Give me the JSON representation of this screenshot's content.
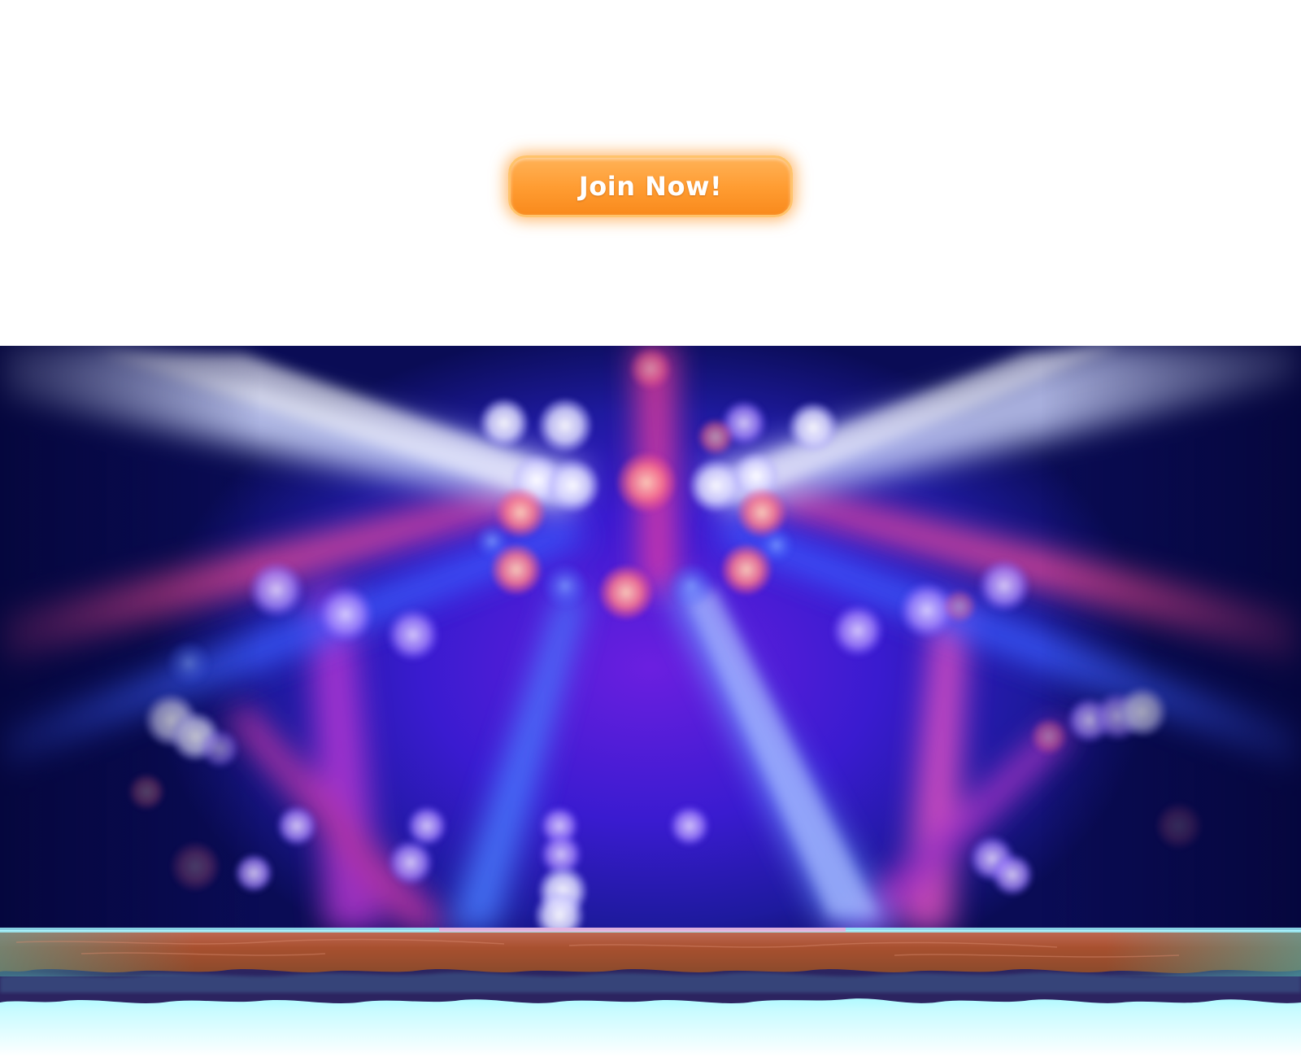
{
  "cta": {
    "label": "Join Now!"
  },
  "stage": {
    "scene": "stage-lights-background"
  },
  "colors": {
    "button_accent": "#ff9d33",
    "button_border": "#ffc36b",
    "stage_primary": "#3a1bd0",
    "stage_highlight": "#ff6aa8",
    "platform_wood": "#a8502f",
    "platform_glow": "#7ff6ff"
  }
}
